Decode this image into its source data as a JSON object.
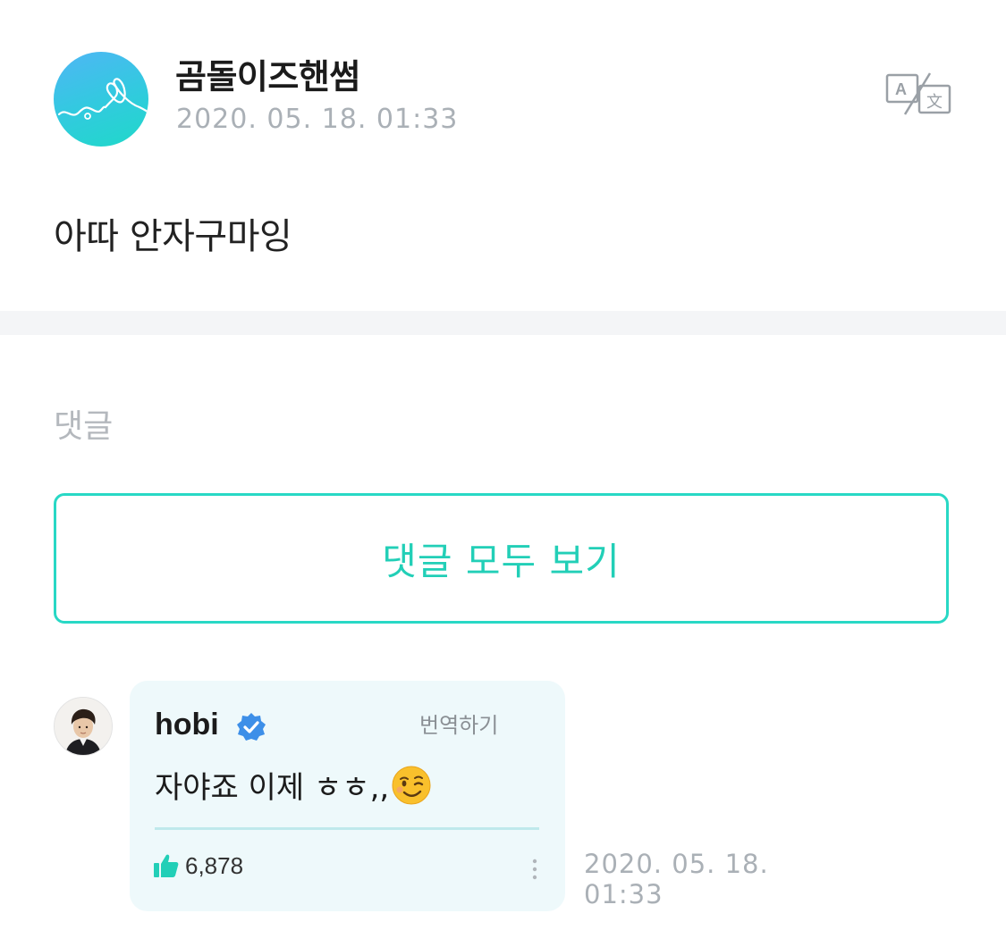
{
  "post": {
    "author_name": "곰돌이즈핸썸",
    "date": "2020. 05. 18. 01:33",
    "body": "아따 안자구마잉",
    "translate_icon": "translate-icon"
  },
  "comments_section": {
    "heading": "댓글",
    "view_all_label": "댓글 모두 보기"
  },
  "comment": {
    "author_name": "hobi",
    "verified": true,
    "translate_label": "번역하기",
    "text": "자야죠 이제 ㅎㅎ,,",
    "emoji": "winking-face",
    "like_count": "6,878",
    "date_line1": "2020. 05. 18.",
    "date_line2": "01:33"
  },
  "colors": {
    "accent": "#22cfb7",
    "accent_border": "#28d8c5",
    "muted_text": "#aab0b6",
    "bubble_bg": "#eef9fb",
    "verified_blue": "#3d8fe8"
  }
}
